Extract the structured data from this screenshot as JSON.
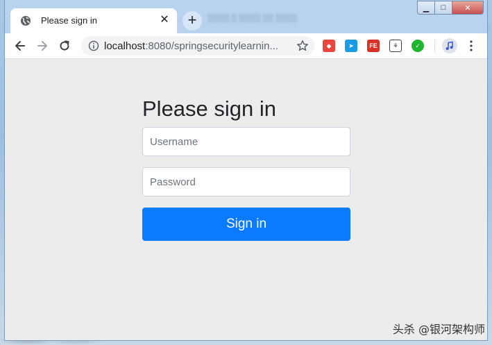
{
  "browser": {
    "tab": {
      "title": "Please sign in",
      "close_glyph": "✕",
      "favicon_icon": "globe-icon"
    },
    "new_tab_glyph": "+",
    "address": {
      "host": "localhost",
      "path": ":8080/springsecuritylearnin...",
      "info_icon": "info-icon",
      "bookmark_icon": "star-icon"
    },
    "window_controls": {
      "minimize": "▁",
      "maximize": "□",
      "close": "✕"
    },
    "extensions": [
      {
        "name": "cube-extension-icon",
        "color": "#e8453c",
        "glyph": "◆"
      },
      {
        "name": "paper-plane-extension-icon",
        "color": "#1a9be6",
        "glyph": "➤"
      },
      {
        "name": "fe-extension-icon",
        "color": "#d93025",
        "glyph": "FE"
      },
      {
        "name": "puzzle-extension-icon",
        "color": "#3c4043",
        "glyph": "⚘"
      },
      {
        "name": "check-extension-icon",
        "color": "#1fb52e",
        "glyph": "✓"
      }
    ]
  },
  "login": {
    "heading": "Please sign in",
    "username_placeholder": "Username",
    "password_placeholder": "Password",
    "submit_label": "Sign in",
    "accent_color": "#0a7bff"
  },
  "watermark": "头杀 @银河架构师"
}
